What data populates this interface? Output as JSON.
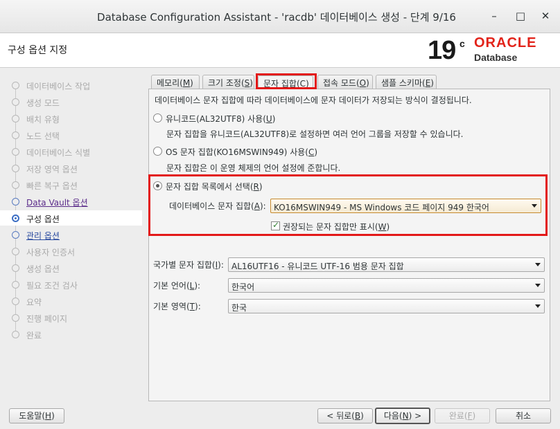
{
  "window": {
    "title": "Database Configuration Assistant - 'racdb' 데이터베이스 생성 - 단계 9/16",
    "controls": {
      "minimize": "–",
      "maximize": "□",
      "close": "✕"
    }
  },
  "header": {
    "page_title": "구성 옵션 지정",
    "logo": {
      "version": "19",
      "superscript": "c",
      "brand": "ORACLE",
      "product": "Database"
    }
  },
  "sidebar": {
    "steps": [
      {
        "label": "데이터베이스 작업",
        "state": "done"
      },
      {
        "label": "생성 모드",
        "state": "done"
      },
      {
        "label": "배치 유형",
        "state": "done"
      },
      {
        "label": "노드 선택",
        "state": "done"
      },
      {
        "label": "데이터베이스 식별",
        "state": "done"
      },
      {
        "label": "저장 영역 옵션",
        "state": "done"
      },
      {
        "label": "빠른 복구 옵션",
        "state": "done"
      },
      {
        "label": "Data Vault 옵션",
        "state": "link"
      },
      {
        "label": "구성 옵션",
        "state": "current"
      },
      {
        "label": "관리 옵션",
        "state": "link"
      },
      {
        "label": "사용자 인증서",
        "state": "pending"
      },
      {
        "label": "생성 옵션",
        "state": "pending"
      },
      {
        "label": "필요 조건 검사",
        "state": "pending"
      },
      {
        "label": "요약",
        "state": "pending"
      },
      {
        "label": "진행 페이지",
        "state": "pending"
      },
      {
        "label": "완료",
        "state": "pending"
      }
    ]
  },
  "tabs": [
    {
      "pre": "메모리(",
      "key": "M",
      "post": ")"
    },
    {
      "pre": "크기 조정(",
      "key": "S",
      "post": ")"
    },
    {
      "pre": "문자 집합(",
      "key": "C",
      "post": ")"
    },
    {
      "pre": "접속 모드(",
      "key": "O",
      "post": ")"
    },
    {
      "pre": "샘플 스키마(",
      "key": "E",
      "post": ")"
    }
  ],
  "charset": {
    "intro": "데이터베이스 문자 집합에 따라 데이터베이스에 문자 데이터가 저장되는 방식이 결정됩니다.",
    "unicode": {
      "pre": "유니코드(AL32UTF8) 사용(",
      "key": "U",
      "post": ")",
      "desc": "문자 집합을 유니코드(AL32UTF8)로 설정하면 여러 언어 그룹을 저장할 수 있습니다."
    },
    "os": {
      "pre": "OS 문자 집합(KO16MSWIN949) 사용(",
      "key": "C",
      "post": ")",
      "desc": "문자 집합은 이 운영 체제의 언어 설정에 준합니다."
    },
    "choose": {
      "pre": "문자 집합 목록에서 선택(",
      "key": "R",
      "post": ")"
    },
    "db_charset": {
      "pre": "데이터베이스 문자 집합(",
      "key": "A",
      "post": "):",
      "value": "KO16MSWIN949 - MS Windows 코드 페이지 949 한국어"
    },
    "recommended": {
      "pre": "권장되는 문자 집합만 표시(",
      "key": "W",
      "post": ")",
      "checked": true
    }
  },
  "national": {
    "ncharset": {
      "pre": "국가별 문자 집합(",
      "key": "I",
      "post": "):",
      "value": "AL16UTF16 - 유니코드 UTF-16 범용 문자 집합"
    },
    "language": {
      "pre": "기본 언어(",
      "key": "L",
      "post": "):",
      "value": "한국어"
    },
    "territory": {
      "pre": "기본 영역(",
      "key": "T",
      "post": "):",
      "value": "한국"
    }
  },
  "footer": {
    "help": {
      "pre": "도움말(",
      "key": "H",
      "post": ")"
    },
    "back": {
      "pre": "< 뒤로(",
      "key": "B",
      "post": ")"
    },
    "next": {
      "pre": "다음(",
      "key": "N",
      "post": ") >"
    },
    "finish": {
      "pre": "완료(",
      "key": "F",
      "post": ")"
    },
    "cancel": "취소"
  }
}
